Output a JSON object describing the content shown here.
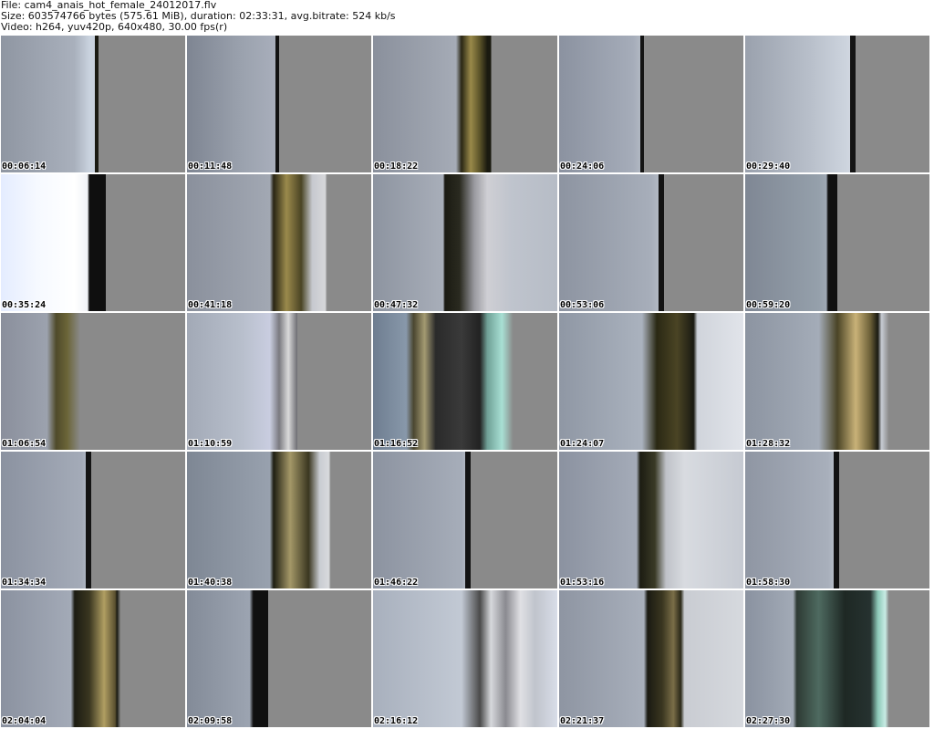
{
  "header": {
    "file_line": "File: cam4_anais_hot_female_24012017.flv",
    "size_line": "Size: 603574766 bytes (575.61 MiB), duration: 02:33:31, avg.bitrate: 524 kb/s",
    "video_line": "Video: h264, yuv420p, 640x480, 30.00 fps(r)"
  },
  "thumbnails": [
    {
      "time": "00:06:14"
    },
    {
      "time": "00:11:48"
    },
    {
      "time": "00:18:22"
    },
    {
      "time": "00:24:06"
    },
    {
      "time": "00:29:40"
    },
    {
      "time": "00:35:24"
    },
    {
      "time": "00:41:18"
    },
    {
      "time": "00:47:32"
    },
    {
      "time": "00:53:06"
    },
    {
      "time": "00:59:20"
    },
    {
      "time": "01:06:54"
    },
    {
      "time": "01:10:59"
    },
    {
      "time": "01:16:52"
    },
    {
      "time": "01:24:07"
    },
    {
      "time": "01:28:32"
    },
    {
      "time": "01:34:34"
    },
    {
      "time": "01:40:38"
    },
    {
      "time": "01:46:22"
    },
    {
      "time": "01:53:16"
    },
    {
      "time": "01:58:30"
    },
    {
      "time": "02:04:04"
    },
    {
      "time": "02:09:58"
    },
    {
      "time": "02:16:12"
    },
    {
      "time": "02:21:37"
    },
    {
      "time": "02:27:30"
    }
  ]
}
